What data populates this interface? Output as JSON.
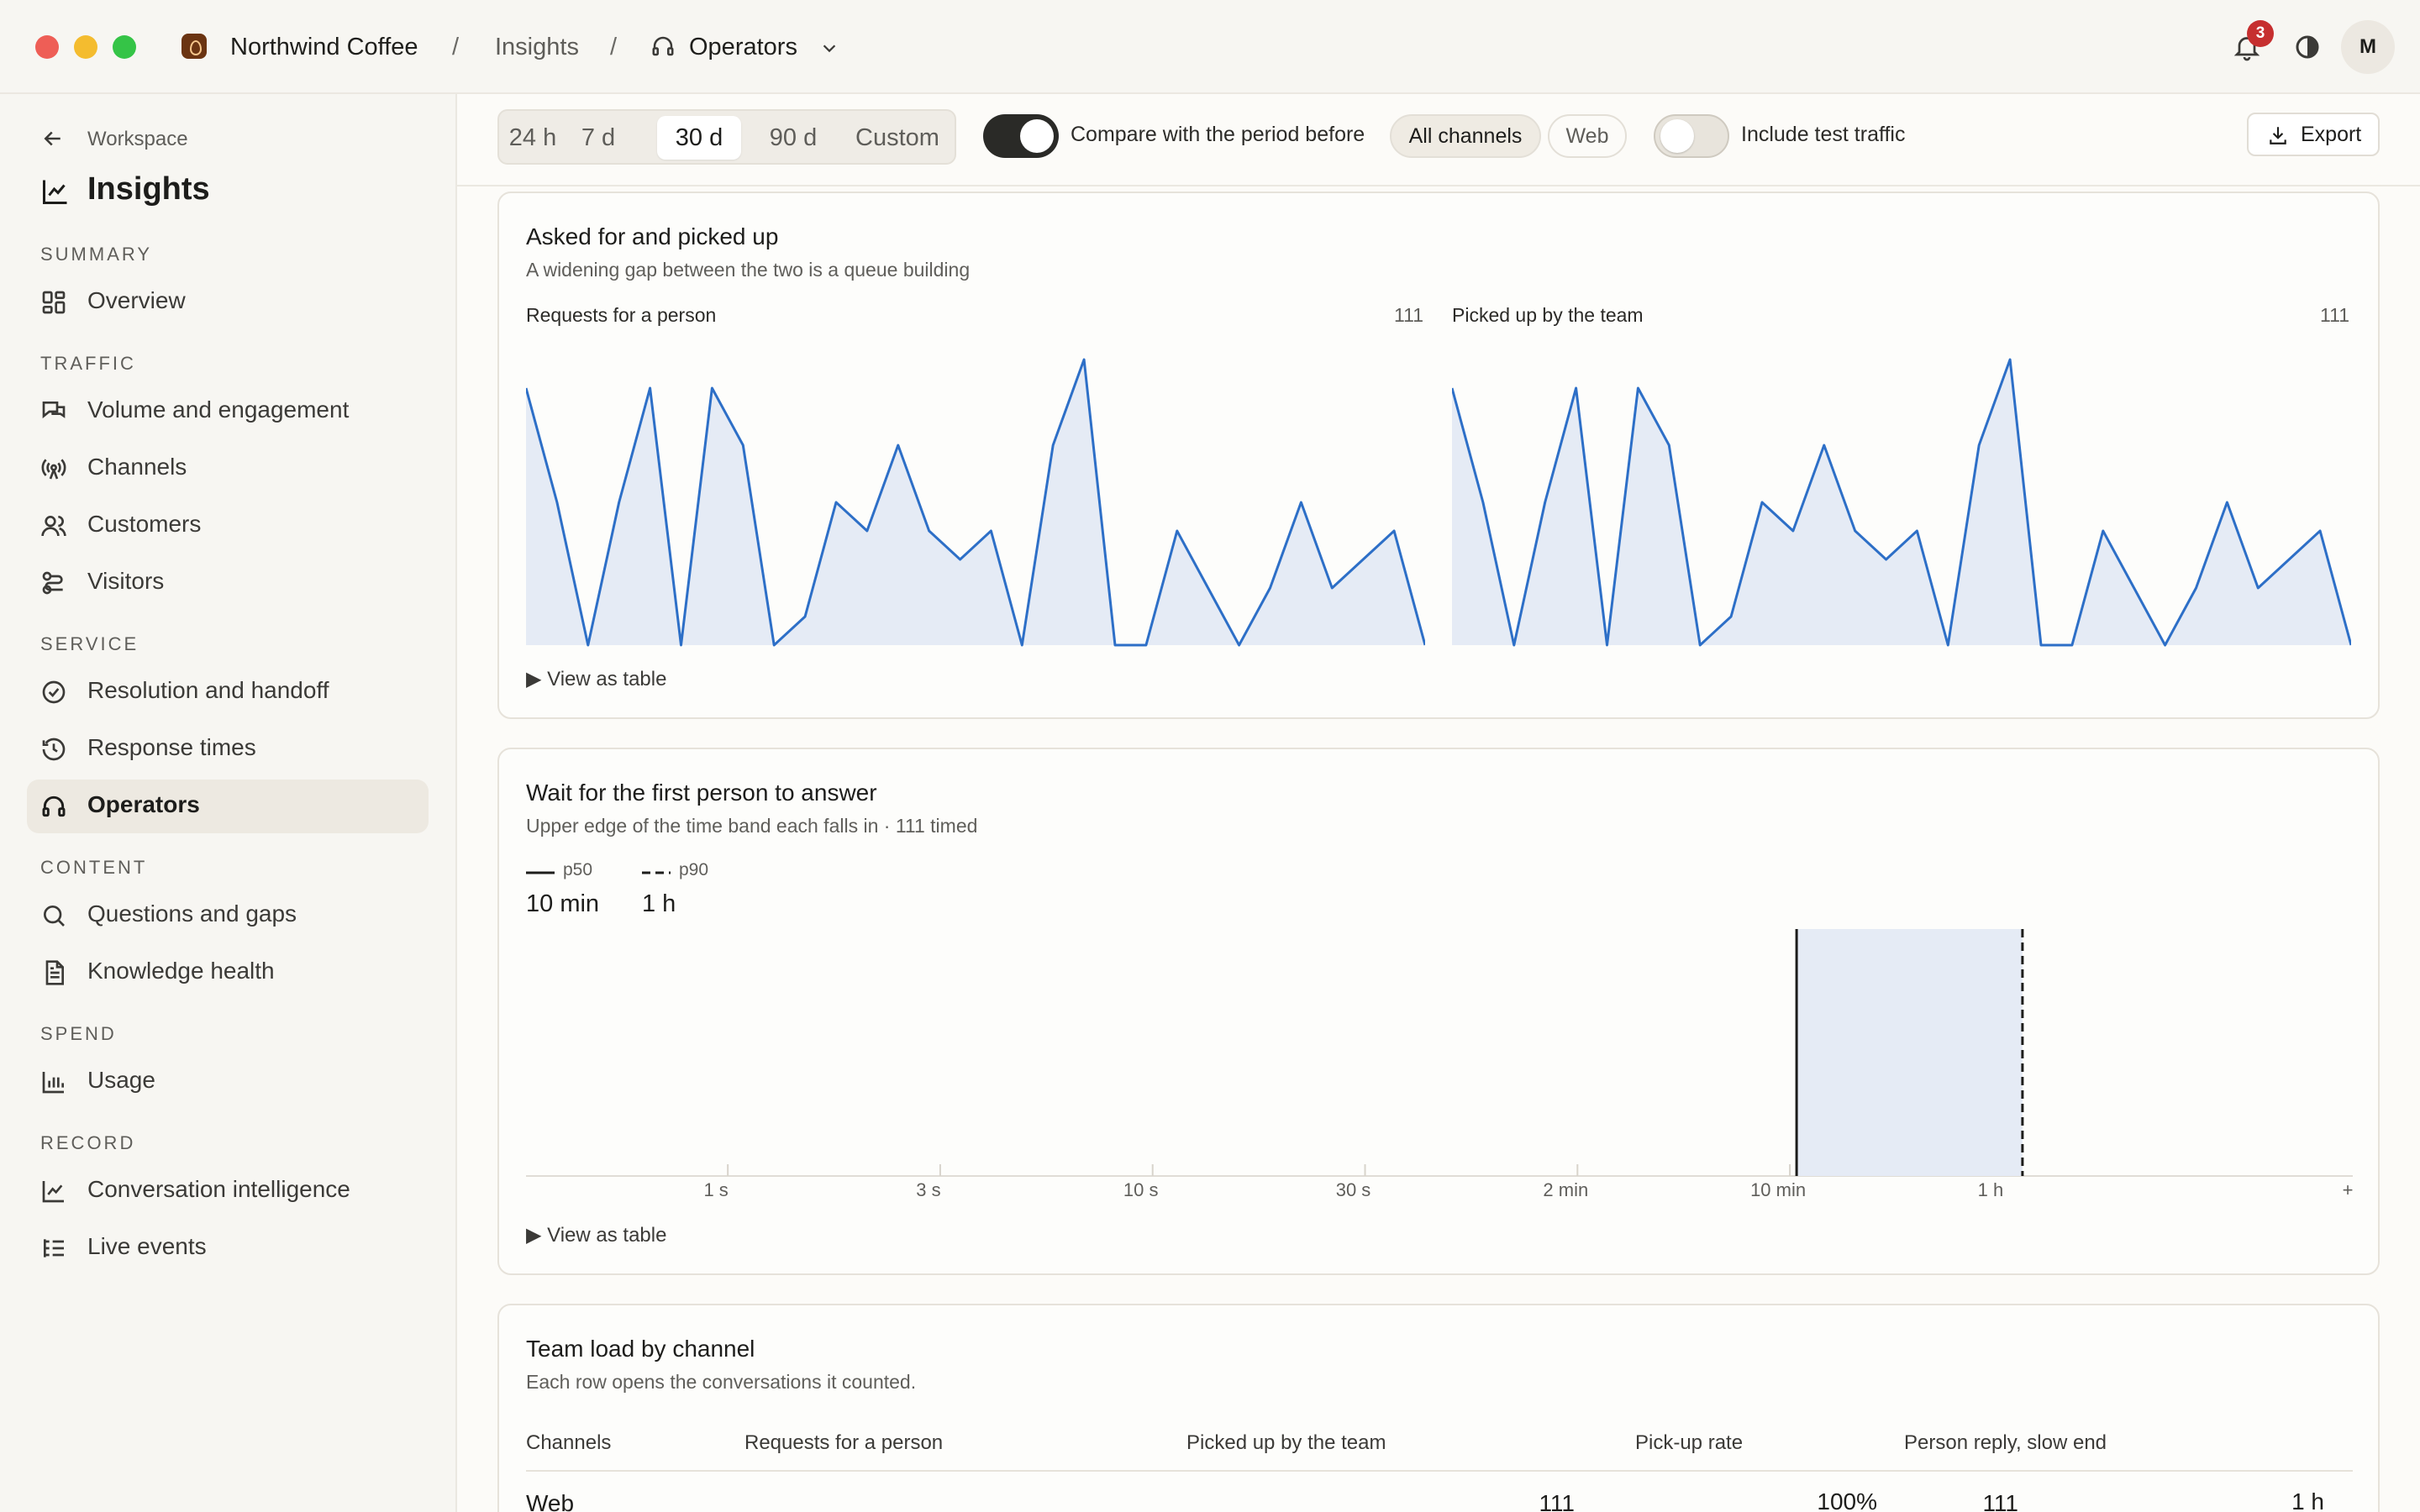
{
  "window": {
    "org": "Northwind Coffee",
    "crumb_sep": "/",
    "section": "Insights",
    "current": "Operators",
    "notification_count": "3",
    "avatar_initial": "M"
  },
  "sidebar": {
    "back_label": "Workspace",
    "title": "Insights",
    "sections": [
      {
        "label": "Summary",
        "items": [
          {
            "label": "Overview",
            "icon": "grid-icon"
          }
        ]
      },
      {
        "label": "Traffic",
        "items": [
          {
            "label": "Volume and engagement",
            "icon": "chat-bubbles-icon"
          },
          {
            "label": "Channels",
            "icon": "broadcast-icon"
          },
          {
            "label": "Customers",
            "icon": "users-icon"
          },
          {
            "label": "Visitors",
            "icon": "route-icon"
          }
        ]
      },
      {
        "label": "Service",
        "items": [
          {
            "label": "Resolution and handoff",
            "icon": "check-circle-icon"
          },
          {
            "label": "Response times",
            "icon": "history-icon"
          },
          {
            "label": "Operators",
            "icon": "headset-icon",
            "active": true
          }
        ]
      },
      {
        "label": "Content",
        "items": [
          {
            "label": "Questions and gaps",
            "icon": "search-icon"
          },
          {
            "label": "Knowledge health",
            "icon": "document-icon"
          }
        ]
      },
      {
        "label": "Spend",
        "items": [
          {
            "label": "Usage",
            "icon": "bar-chart-icon"
          }
        ]
      },
      {
        "label": "Record",
        "items": [
          {
            "label": "Conversation intelligence",
            "icon": "line-chart-icon"
          },
          {
            "label": "Live events",
            "icon": "list-tree-icon"
          }
        ]
      }
    ]
  },
  "filters": {
    "ranges": [
      "24 h",
      "7 d",
      "30 d",
      "90 d",
      "Custom"
    ],
    "active_range": "30 d",
    "compare_label": "Compare with the period before",
    "compare_on": true,
    "channels": [
      "All channels",
      "Web"
    ],
    "active_channel": "All channels",
    "test_traffic_label": "Include test traffic",
    "test_traffic_on": false,
    "export_label": "Export"
  },
  "cards": {
    "asked": {
      "title": "Asked for and picked up",
      "subtitle": "A widening gap between the two is a queue building",
      "left_label": "Requests for a person",
      "left_count": "111",
      "right_label": "Picked up by the team",
      "right_count": "111",
      "view_table": "▶ View as table"
    },
    "wait": {
      "title": "Wait for the first person to answer",
      "subtitle": "Upper edge of the time band each falls in · 111 timed",
      "p50_label": "p50",
      "p50_value": "10 min",
      "p90_label": "p90",
      "p90_value": "1 h",
      "view_table": "▶ View as table"
    },
    "team": {
      "title": "Team load by channel",
      "subtitle": "Each row opens the conversations it counted.",
      "columns": [
        "Channels",
        "Requests for a person",
        "Picked up by the team",
        "Pick-up rate",
        "Person reply, slow end"
      ],
      "rows": [
        {
          "channel": "Web",
          "requests": "111",
          "picked": "111",
          "rate": "100%",
          "slow_end": "1 h"
        }
      ]
    }
  },
  "chart_data": [
    {
      "type": "area",
      "title": "Requests for a person",
      "x": [
        1,
        2,
        3,
        4,
        5,
        6,
        7,
        8,
        9,
        10,
        11,
        12,
        13,
        14,
        15,
        16,
        17,
        18,
        19,
        20,
        21,
        22,
        23,
        24,
        25,
        26,
        27,
        28,
        29,
        30
      ],
      "series": [
        {
          "name": "Requests for a person",
          "values": [
            9,
            5,
            0,
            5,
            9,
            0,
            9,
            7,
            0,
            1,
            5,
            4,
            7,
            4,
            3,
            4,
            0,
            7,
            10,
            0,
            0,
            4,
            2,
            0,
            2,
            5,
            2,
            3,
            4,
            0
          ]
        }
      ],
      "ylim": [
        0,
        10
      ]
    },
    {
      "type": "area",
      "title": "Picked up by the team",
      "x": [
        1,
        2,
        3,
        4,
        5,
        6,
        7,
        8,
        9,
        10,
        11,
        12,
        13,
        14,
        15,
        16,
        17,
        18,
        19,
        20,
        21,
        22,
        23,
        24,
        25,
        26,
        27,
        28,
        29,
        30
      ],
      "series": [
        {
          "name": "Picked up by the team",
          "values": [
            9,
            5,
            0,
            5,
            9,
            0,
            9,
            7,
            0,
            1,
            5,
            4,
            7,
            4,
            3,
            4,
            0,
            7,
            10,
            0,
            0,
            4,
            2,
            0,
            2,
            5,
            2,
            3,
            4,
            0
          ]
        }
      ],
      "ylim": [
        0,
        10
      ]
    },
    {
      "type": "bar",
      "title": "Wait for the first person to answer",
      "categories": [
        "1 s",
        "3 s",
        "10 s",
        "30 s",
        "2 min",
        "10 min",
        "1 h",
        "+"
      ],
      "band": {
        "from": "10 min",
        "to": "1 h"
      },
      "markers": [
        {
          "name": "p50",
          "value": "10 min"
        },
        {
          "name": "p90",
          "value": "1 h"
        }
      ]
    }
  ]
}
